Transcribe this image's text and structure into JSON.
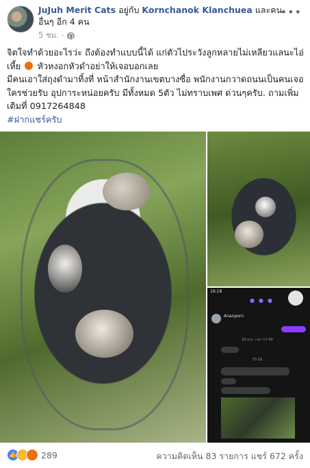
{
  "header": {
    "author": "JuJuh Merit Cats",
    "with_text": "อยู่กับ",
    "tagged_person": "Kornchanok Klanchuea",
    "and_others": "และคนอื่นๆ อีก 4 คน",
    "time": "5 ชม.",
    "separator": "·",
    "more_label": "•••"
  },
  "post": {
    "line1": "จิตใจทำด้วยอะไรว่ะ ถึงต้องทำแบบนี้ได้ แก่ตัวไประวังลูกหลายไม่เหลียวแลนะไอ่เหี้ย",
    "line1_end": "หัวหงอกหัวดำอย่าให้เจอบอกเลย",
    "line2": "มีคนเอาใส่ถุงดำมาทิ้งที่ หน้าสำนักงานเขตบางซื่อ พนักงานกวาดถนนเป็นคนเจอ ใครช่วยรับ อุปการะหน่อยครับ มีทั้งหมด 5ตัว ไม่ทราบเพศ ด่วนๆครับ. ถามเพิ่มเติมที่ 0917264848",
    "hashtag": "#ฝากแชร์ครับ"
  },
  "phone_screenshot": {
    "status_time": "16:18",
    "contact_name": "Ananporn",
    "date_1": "29 ต.ค. เวลา 17:40",
    "date_2": "15:16"
  },
  "footer": {
    "reaction_count": "289",
    "stats": "ความคิดเห็น 83 รายการ  แชร์ 672 ครั้ง"
  },
  "colors": {
    "link": "#385898",
    "like": "#4f7cf7",
    "sad": "#f7b928",
    "angry": "#e9710f"
  },
  "icons": [
    "globe-icon",
    "more-icon",
    "like-icon",
    "sad-icon",
    "angry-icon",
    "angry-face-emoji"
  ]
}
